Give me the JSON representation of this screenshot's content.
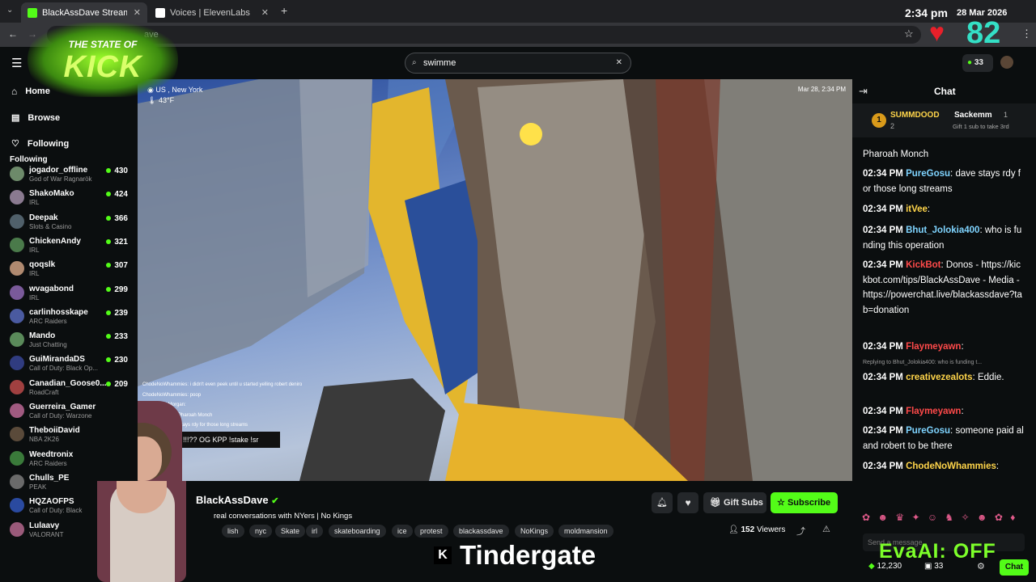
{
  "browser": {
    "tabs": [
      {
        "label": "BlackAssDave Stream - Wat",
        "active": true
      },
      {
        "label": "Voices | ElevenLabs",
        "active": false
      }
    ],
    "url": "ave"
  },
  "overlay": {
    "logo_line1": "THE STATE OF",
    "logo_line2": "KICK",
    "clock": "2:34 pm",
    "date": "28 Mar 2026",
    "heart_count": "82",
    "banner_text": "Tindergate",
    "evaai": "EvaAI: OFF"
  },
  "header": {
    "search_value": "swimme",
    "notif_count": "33"
  },
  "sidebar": {
    "nav": [
      "Home",
      "Browse",
      "Following"
    ],
    "following_heading": "Following",
    "channels": [
      {
        "name": "jogador_offline",
        "game": "God of War Ragnarök",
        "viewers": "430",
        "color": "#6d8a6a"
      },
      {
        "name": "ShakoMako",
        "game": "IRL",
        "viewers": "424",
        "color": "#8a7a90"
      },
      {
        "name": "Deepak",
        "game": "Slots & Casino",
        "viewers": "366",
        "color": "#50606a"
      },
      {
        "name": "ChickenAndy",
        "game": "IRL",
        "viewers": "321",
        "color": "#4a7a4a"
      },
      {
        "name": "qoqslk",
        "game": "IRL",
        "viewers": "307",
        "color": "#b08a70"
      },
      {
        "name": "wvagabond",
        "game": "IRL",
        "viewers": "299",
        "color": "#7a5a9a"
      },
      {
        "name": "carlinhosskape",
        "game": "ARC Raiders",
        "viewers": "239",
        "color": "#4a5aa0"
      },
      {
        "name": "Mando",
        "game": "Just Chatting",
        "viewers": "233",
        "color": "#5a8a5a"
      },
      {
        "name": "GuiMirandaDS",
        "game": "Call of Duty: Black Op...",
        "viewers": "230",
        "color": "#303c80"
      },
      {
        "name": "Canadian_Goose0...",
        "game": "RoadCraft",
        "viewers": "209",
        "color": "#a04040"
      },
      {
        "name": "Guerreira_Gamer",
        "game": "Call of Duty: Warzone",
        "viewers": "",
        "color": "#a05a80"
      },
      {
        "name": "TheboiiDavid",
        "game": "NBA 2K26",
        "viewers": "",
        "color": "#5a4a3a"
      },
      {
        "name": "Weedtronix",
        "game": "ARC Raiders",
        "viewers": "",
        "color": "#3a7a3a"
      },
      {
        "name": "Chulls_PE",
        "game": "PEAK",
        "viewers": "",
        "color": "#6a6a6a"
      },
      {
        "name": "HQZAOFPS",
        "game": "Call of Duty: Black",
        "viewers": "",
        "color": "#2a4aa0"
      },
      {
        "name": "Lulaavy",
        "game": "VALORANT",
        "viewers": "",
        "color": "#9a5a7a"
      }
    ]
  },
  "video": {
    "location": "US , New York",
    "temp": "43°F",
    "datetime": "Mar 28, 2:34 PM",
    "overlay_chat": [
      "ChodeNoWhammies: i didn't even peek until u started yelling robert deniro",
      "ChodeNoWhammies: poop",
      "FakePatrickMorgan:",
      "PharoahMonch: Pharoah Monch",
      "PureGosu: dave stays rdy for those long streams"
    ],
    "kpp_text": "!!!?? OG KPP !stake !sr"
  },
  "stream": {
    "streamer": "BlackAssDave",
    "title": "real conversations with NYers | No Kings",
    "tags": [
      "lish",
      "nyc",
      "Skate",
      "irl",
      "skateboarding",
      "ice",
      "protest",
      "blackassdave",
      "NoKings",
      "moldmansion"
    ],
    "viewers": "152",
    "viewers_label": "Viewers",
    "gift_label": "Gift Subs",
    "subscribe_label": "Subscribe"
  },
  "chat": {
    "title": "Chat",
    "pinned": {
      "rank": "1",
      "user1": "SUMMDOOD",
      "user1_count": "2",
      "user2": "Sackemm",
      "user2_count": "1",
      "note": "Gift 1 sub to take 3rd"
    },
    "messages": [
      {
        "time": "",
        "user": "",
        "color": "#fff",
        "text": "Pharoah Monch"
      },
      {
        "time": "02:34 PM",
        "user": "PureGosu",
        "color": "#7fd4ff",
        "text": "dave stays rdy for those long streams"
      },
      {
        "time": "02:34 PM",
        "user": "itVee",
        "color": "#ffd54a",
        "text": ""
      },
      {
        "time": "02:34 PM",
        "user": "Bhut_Jolokia400",
        "color": "#7fd4ff",
        "text": "who is funding this operation"
      },
      {
        "time": "02:34 PM",
        "user": "KickBot",
        "color": "#ff4a4a",
        "text": "Donos - https://kickbot.com/tips/BlackAssDave - Media - https://powerchat.live/blackassdave?tab=donation"
      },
      {
        "time": "02:34 PM",
        "user": "Flaymeyawn",
        "color": "#ff4a4a",
        "text": ""
      },
      {
        "time": "02:34 PM",
        "user": "creativezealots",
        "color": "#ffd54a",
        "text": "Eddie."
      },
      {
        "time": "02:34 PM",
        "user": "Flaymeyawn",
        "color": "#ff4a4a",
        "text": ""
      },
      {
        "time": "02:34 PM",
        "user": "PureGosu",
        "color": "#7fd4ff",
        "text": "someone paid al and robert to be there"
      },
      {
        "time": "02:34 PM",
        "user": "ChodeNoWhammies",
        "color": "#ffd54a",
        "text": ""
      }
    ],
    "reply_note": "Replying to Bhut_Jolokia400: who is funding t...",
    "send_placeholder": "Send a message",
    "points": "12,230",
    "footer_count": "33",
    "chat_button": "Chat"
  }
}
